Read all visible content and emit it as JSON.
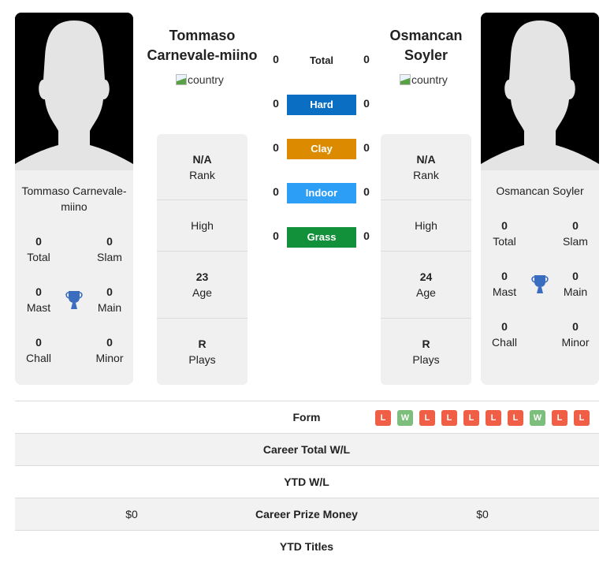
{
  "colors": {
    "hard": "#0a6fc2",
    "clay": "#dc8b00",
    "indoor": "#2d9ef5",
    "grass": "#12913a",
    "win": "#7cbf7c",
    "loss": "#ef5e45",
    "trophy": "#3a6cbf"
  },
  "player1": {
    "name": "Tommaso Carnevale-miino",
    "name_line1": "Tommaso",
    "name_line2": "Carnevale-miino",
    "small_name_line1": "Tommaso Carnevale-",
    "small_name_line2": "miino",
    "country_alt": "country",
    "titles": {
      "total": {
        "value": "0",
        "label": "Total"
      },
      "slam": {
        "value": "0",
        "label": "Slam"
      },
      "mast": {
        "value": "0",
        "label": "Mast"
      },
      "main": {
        "value": "0",
        "label": "Main"
      },
      "chall": {
        "value": "0",
        "label": "Chall"
      },
      "minor": {
        "value": "0",
        "label": "Minor"
      }
    },
    "rank": {
      "value": "N/A",
      "label": "Rank"
    },
    "high": {
      "label": "High"
    },
    "age": {
      "value": "23",
      "label": "Age"
    },
    "plays": {
      "value": "R",
      "label": "Plays"
    },
    "prize_money": "$0"
  },
  "player2": {
    "name": "Osmancan Soyler",
    "name_line1": "Osmancan",
    "name_line2": "Soyler",
    "small_name": "Osmancan Soyler",
    "country_alt": "country",
    "titles": {
      "total": {
        "value": "0",
        "label": "Total"
      },
      "slam": {
        "value": "0",
        "label": "Slam"
      },
      "mast": {
        "value": "0",
        "label": "Mast"
      },
      "main": {
        "value": "0",
        "label": "Main"
      },
      "chall": {
        "value": "0",
        "label": "Chall"
      },
      "minor": {
        "value": "0",
        "label": "Minor"
      }
    },
    "rank": {
      "value": "N/A",
      "label": "Rank"
    },
    "high": {
      "label": "High"
    },
    "age": {
      "value": "24",
      "label": "Age"
    },
    "plays": {
      "value": "R",
      "label": "Plays"
    },
    "prize_money": "$0"
  },
  "surfaces": [
    {
      "label": "Total",
      "p1": "0",
      "p2": "0"
    },
    {
      "label": "Hard",
      "p1": "0",
      "p2": "0"
    },
    {
      "label": "Clay",
      "p1": "0",
      "p2": "0"
    },
    {
      "label": "Indoor",
      "p1": "0",
      "p2": "0"
    },
    {
      "label": "Grass",
      "p1": "0",
      "p2": "0"
    }
  ],
  "table": {
    "form_label": "Form",
    "form": [
      "L",
      "W",
      "L",
      "L",
      "L",
      "L",
      "L",
      "W",
      "L",
      "L"
    ],
    "career_wl_label": "Career Total W/L",
    "ytd_wl_label": "YTD W/L",
    "prize_label": "Career Prize Money",
    "ytd_titles_label": "YTD Titles"
  }
}
